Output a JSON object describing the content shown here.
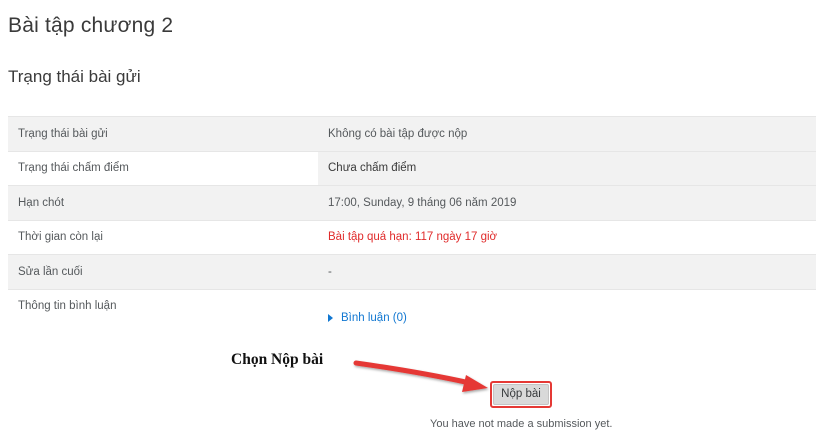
{
  "page": {
    "title": "Bài tập chương 2",
    "section_title": "Trạng thái bài gửi"
  },
  "status_table": {
    "rows": [
      {
        "label": "Trạng thái bài gửi",
        "value": "Không có bài tập được nộp"
      },
      {
        "label": "Trạng thái chấm điểm",
        "value": "Chưa chấm điểm"
      },
      {
        "label": "Hạn chót",
        "value": "17:00, Sunday, 9 tháng 06 năm 2019"
      },
      {
        "label": "Thời gian còn lại",
        "value": "Bài tập quá hạn: 117 ngày 17 giờ"
      },
      {
        "label": "Sửa lần cuối",
        "value": "-"
      },
      {
        "label": "Thông tin bình luận",
        "value": "Bình luận (0)"
      }
    ]
  },
  "annotation": {
    "label": "Chọn Nộp bài",
    "color": "#e53935"
  },
  "submit": {
    "button_label": "Nộp bài",
    "note": "You have not made a submission yet."
  },
  "colors": {
    "overdue": "#e02b2b",
    "link": "#1177d1",
    "row_stripe": "#f2f2f2"
  }
}
